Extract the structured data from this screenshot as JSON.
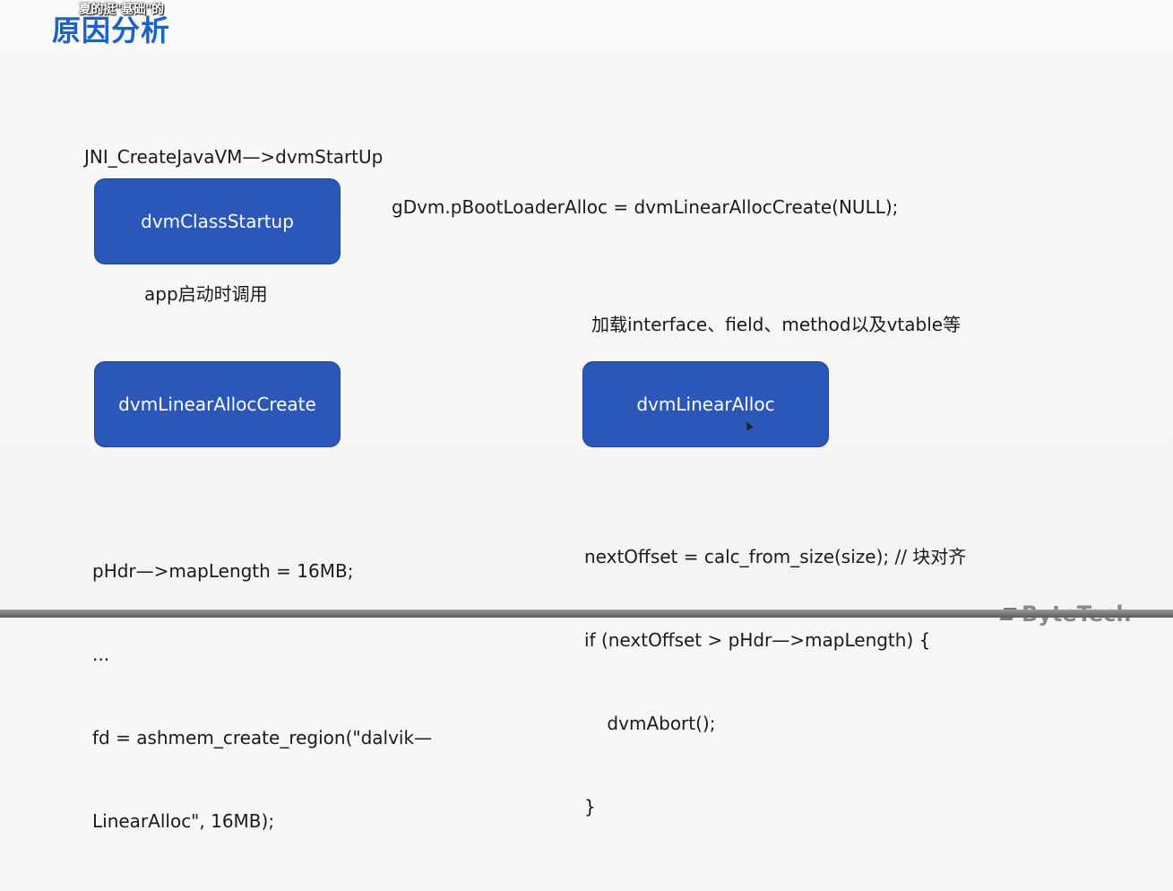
{
  "overlay": {
    "subtitle": "夏的挺\"基础\"的"
  },
  "slide": {
    "title": "原因分析",
    "entry_call": "JNI_CreateJavaVM—>dvmStartUp",
    "boot_loader_code": "gDvm.pBootLoaderAlloc = dvmLinearAllocCreate(NULL);",
    "caption_startup": "app启动时调用",
    "caption_load": "加载interface、field、method以及vtable等",
    "boxes": {
      "class_startup": "dvmClassStartup",
      "linear_alloc_create": "dvmLinearAllocCreate",
      "linear_alloc": "dvmLinearAlloc"
    },
    "left_code": [
      "pHdr—>mapLength = 16MB;",
      "...",
      "fd = ashmem_create_region(\"dalvik—",
      "LinearAlloc\", 16MB);"
    ],
    "right_code": [
      "nextOffset = calc_from_size(size); // 块对齐",
      "if (nextOffset > pHdr—>mapLength) {",
      "    dvmAbort();",
      "}"
    ]
  },
  "brand": {
    "name": "ByteTech"
  },
  "colors": {
    "title": "#1a62c9",
    "box_fill": "#2b57b8",
    "box_border": "#1d449a",
    "box_text": "#ffffff"
  }
}
